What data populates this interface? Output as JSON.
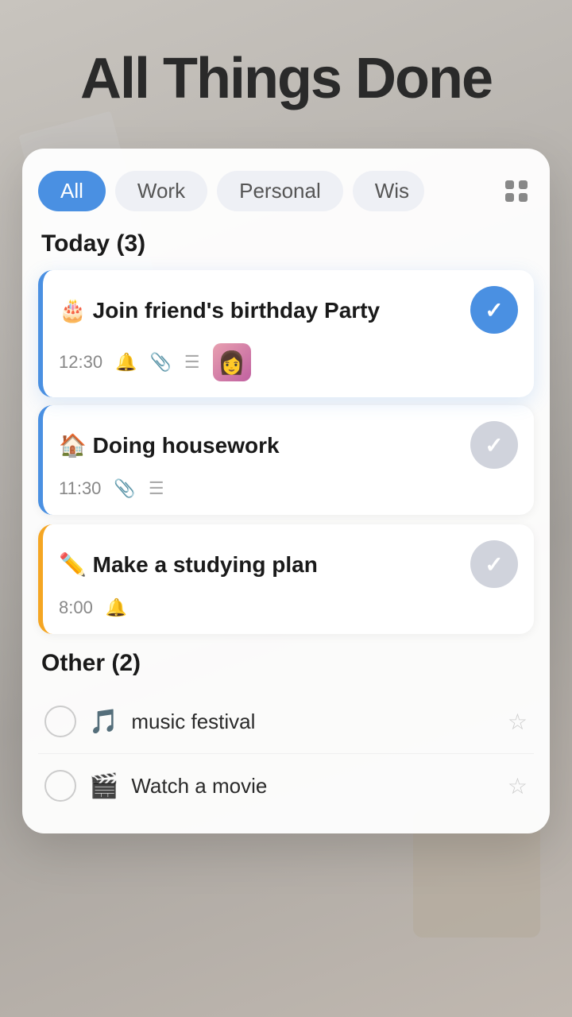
{
  "app": {
    "title": "All Things Done"
  },
  "filters": {
    "all_label": "All",
    "work_label": "Work",
    "personal_label": "Personal",
    "wish_label": "Wis",
    "grid_icon_name": "grid-icon"
  },
  "today_section": {
    "header": "Today (3)",
    "tasks": [
      {
        "id": "task-1",
        "emoji": "🎂",
        "title": "Join friend's birthday Party",
        "time": "12:30",
        "has_bell": true,
        "has_attachment": true,
        "has_list": true,
        "has_thumb": true,
        "completed": true,
        "accent": "blue"
      },
      {
        "id": "task-2",
        "emoji": "🏠",
        "title": "Doing housework",
        "time": "11:30",
        "has_bell": false,
        "has_attachment": true,
        "has_list": true,
        "has_thumb": false,
        "completed": false,
        "accent": "blue"
      },
      {
        "id": "task-3",
        "emoji": "✏️",
        "title": "Make a studying plan",
        "time": "8:00",
        "has_bell": true,
        "has_attachment": false,
        "has_list": false,
        "has_thumb": false,
        "completed": false,
        "accent": "yellow"
      }
    ]
  },
  "other_section": {
    "header": "Other (2)",
    "tasks": [
      {
        "id": "other-1",
        "emoji": "🎵",
        "title": "music festival",
        "starred": false
      },
      {
        "id": "other-2",
        "emoji": "🎬",
        "title": "Watch a movie",
        "starred": false
      }
    ]
  },
  "icons": {
    "bell": "🔔",
    "attachment": "📎",
    "list": "☰",
    "check": "✓",
    "star_empty": "☆"
  }
}
